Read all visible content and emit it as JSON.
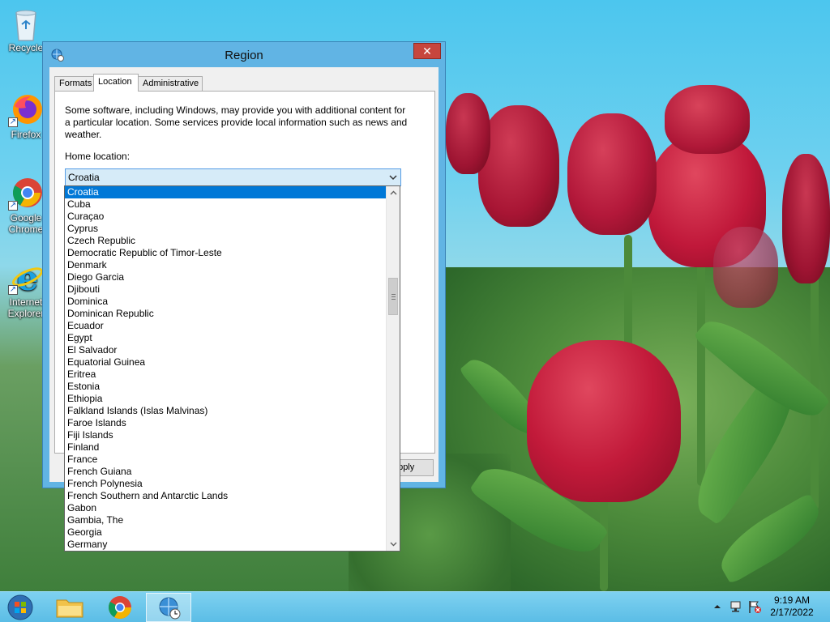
{
  "desktop": {
    "icons": [
      {
        "label": "Recycle",
        "name": "recycle-bin-icon"
      },
      {
        "label": "Firefox",
        "name": "firefox-icon"
      },
      {
        "label": "Google Chrome",
        "name": "chrome-icon"
      },
      {
        "label": "Internet Explorer",
        "name": "ie-icon"
      }
    ]
  },
  "dialog": {
    "title": "Region",
    "close_glyph": "✕",
    "tabs": [
      {
        "label": "Formats"
      },
      {
        "label": "Location"
      },
      {
        "label": "Administrative"
      }
    ],
    "active_tab": "Location",
    "description": "Some software, including Windows, may provide you with additional content for a particular location. Some services provide local information such as news and weather.",
    "home_location_label": "Home location:",
    "home_location_value": "Croatia",
    "apply_label": "Apply"
  },
  "dropdown": {
    "selected": "Croatia",
    "items": [
      "Croatia",
      "Cuba",
      "Curaçao",
      "Cyprus",
      "Czech Republic",
      "Democratic Republic of Timor-Leste",
      "Denmark",
      "Diego Garcia",
      "Djibouti",
      "Dominica",
      "Dominican Republic",
      "Ecuador",
      "Egypt",
      "El Salvador",
      "Equatorial Guinea",
      "Eritrea",
      "Estonia",
      "Ethiopia",
      "Falkland Islands (Islas Malvinas)",
      "Faroe Islands",
      "Fiji Islands",
      "Finland",
      "France",
      "French Guiana",
      "French Polynesia",
      "French Southern and Antarctic Lands",
      "Gabon",
      "Gambia, The",
      "Georgia",
      "Germany"
    ]
  },
  "taskbar": {
    "time": "9:19 AM",
    "date": "2/17/2022",
    "buttons": [
      "start-button",
      "file-explorer-icon",
      "chrome-icon",
      "region-settings-icon"
    ]
  },
  "colors": {
    "selection": "#0078d7",
    "close_button": "#c7463d",
    "dialog_frame": "#61b4e4",
    "taskbar": "#5bbde6"
  }
}
